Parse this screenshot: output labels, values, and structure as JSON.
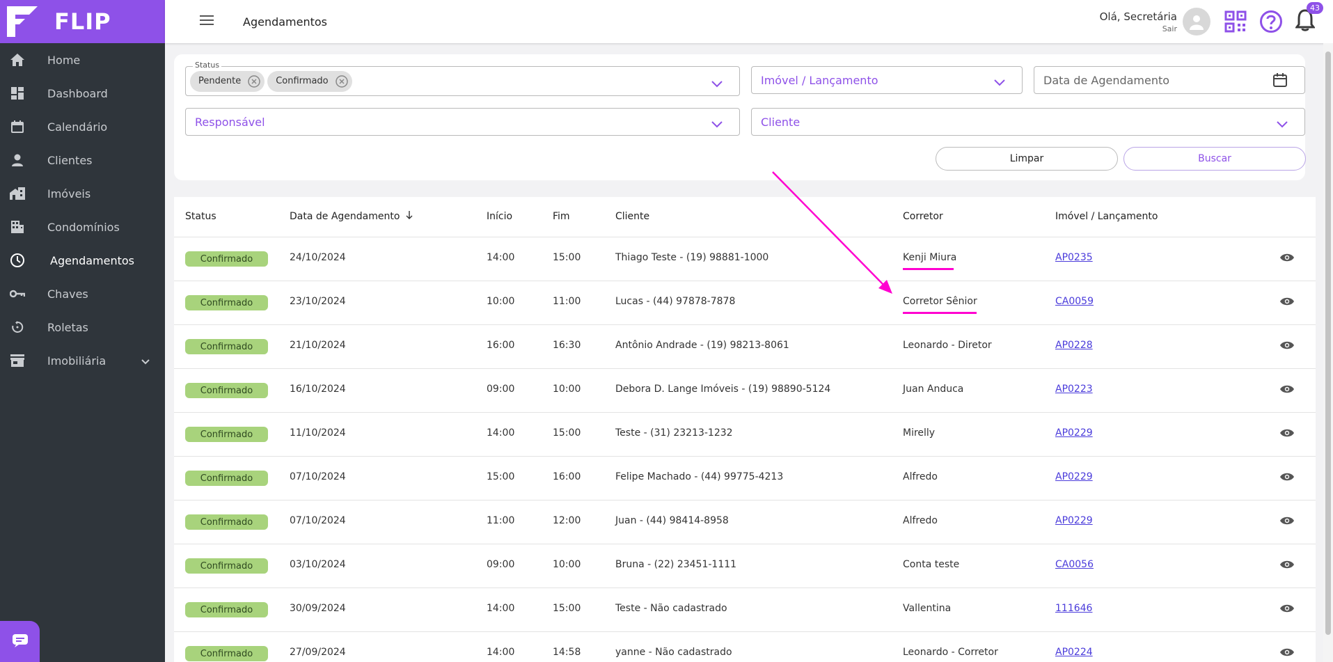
{
  "app": {
    "brand": "FLIP",
    "accent": "#8e51e8"
  },
  "sidebar": {
    "items": [
      {
        "label": "Home",
        "icon": "home-icon"
      },
      {
        "label": "Dashboard",
        "icon": "dashboard-icon"
      },
      {
        "label": "Calendário",
        "icon": "calendar-icon"
      },
      {
        "label": "Clientes",
        "icon": "person-icon"
      },
      {
        "label": "Imóveis",
        "icon": "building-icon"
      },
      {
        "label": "Condomínios",
        "icon": "apartment-icon"
      },
      {
        "label": "Agendamentos",
        "icon": "clock-icon"
      },
      {
        "label": "Chaves",
        "icon": "key-icon"
      },
      {
        "label": "Roletas",
        "icon": "rotate-icon"
      },
      {
        "label": "Imobiliária",
        "icon": "store-icon"
      }
    ],
    "active": "Agendamentos"
  },
  "header": {
    "title": "Agendamentos",
    "greeting": "Olá, Secretária",
    "logout": "Sair",
    "notifications_count": "43"
  },
  "filters": {
    "status_legend": "Status",
    "status_chips": [
      "Pendente",
      "Confirmado"
    ],
    "imovel_placeholder": "Imóvel / Lançamento",
    "date_placeholder": "Data de Agendamento",
    "responsavel_placeholder": "Responsável",
    "cliente_placeholder": "Cliente",
    "clear_label": "Limpar",
    "search_label": "Buscar"
  },
  "table": {
    "columns": {
      "status": "Status",
      "date": "Data de Agendamento",
      "start": "Início",
      "end": "Fim",
      "client": "Cliente",
      "broker": "Corretor",
      "property": "Imóvel / Lançamento"
    },
    "rows": [
      {
        "status": "Confirmado",
        "date": "24/10/2024",
        "start": "14:00",
        "end": "15:00",
        "client": "Thiago Teste - (19) 98881-1000",
        "broker": "Kenji Miura",
        "property": "AP0235"
      },
      {
        "status": "Confirmado",
        "date": "23/10/2024",
        "start": "10:00",
        "end": "11:00",
        "client": "Lucas - (44) 97878-7878",
        "broker": "Corretor Sênior",
        "property": "CA0059"
      },
      {
        "status": "Confirmado",
        "date": "21/10/2024",
        "start": "16:00",
        "end": "16:30",
        "client": "Antônio Andrade - (19) 98213-8061",
        "broker": "Leonardo - Diretor",
        "property": "AP0228"
      },
      {
        "status": "Confirmado",
        "date": "16/10/2024",
        "start": "09:00",
        "end": "10:00",
        "client": "Debora D. Lange Imóveis - (19) 98890-5124",
        "broker": "Juan Anduca",
        "property": "AP0223"
      },
      {
        "status": "Confirmado",
        "date": "11/10/2024",
        "start": "14:00",
        "end": "15:00",
        "client": "Teste - (31) 23213-1232",
        "broker": "Mirelly",
        "property": "AP0229"
      },
      {
        "status": "Confirmado",
        "date": "07/10/2024",
        "start": "15:00",
        "end": "16:00",
        "client": "Felipe Machado - (44) 99775-4213",
        "broker": "Alfredo",
        "property": "AP0229"
      },
      {
        "status": "Confirmado",
        "date": "07/10/2024",
        "start": "11:00",
        "end": "12:00",
        "client": "Juan - (44) 98414-8958",
        "broker": "Alfredo",
        "property": "AP0229"
      },
      {
        "status": "Confirmado",
        "date": "03/10/2024",
        "start": "09:00",
        "end": "10:00",
        "client": "Bruna - (22) 23451-1111",
        "broker": "Conta teste",
        "property": "CA0056"
      },
      {
        "status": "Confirmado",
        "date": "30/09/2024",
        "start": "14:00",
        "end": "15:00",
        "client": "Teste - Não cadastrado",
        "broker": "Vallentina",
        "property": "111646"
      },
      {
        "status": "Confirmado",
        "date": "27/09/2024",
        "start": "14:00",
        "end": "14:58",
        "client": "yanne - Não cadastrado",
        "broker": "Leonardo - Corretor",
        "property": "AP0224"
      }
    ]
  }
}
